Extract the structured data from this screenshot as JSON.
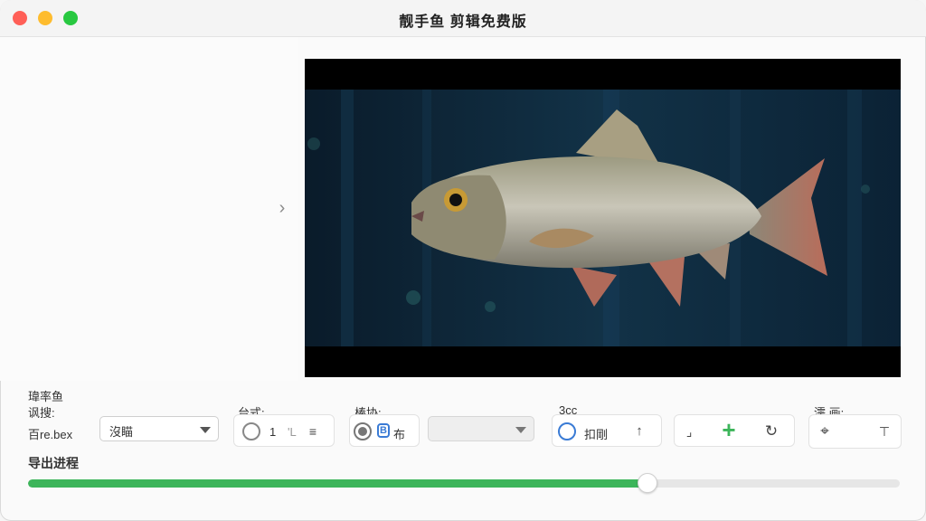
{
  "window": {
    "title": "靓手鱼 剪辑免费版"
  },
  "icons": {
    "chevron": "chevron-right-icon",
    "filter": "filter-lines-icon",
    "arrow_up": "arrow-up-icon",
    "crop": "crop-icon",
    "add": "plus-icon",
    "rotate": "rotate-icon",
    "target": "target-icon",
    "text": "text-icon"
  },
  "colors": {
    "accent_green": "#3cb55a",
    "accent_blue": "#3a7bd5"
  },
  "settings": {
    "section_title": "瑋率鱼",
    "group1": {
      "label": "讽搜:",
      "value_text": "百re.bex",
      "select_value": "沒瞄"
    },
    "group2": {
      "label": "台式:",
      "option_number": "1",
      "option_extra": "'L"
    },
    "group3": {
      "label": "棒协:",
      "badge": "B",
      "badge_text": "布",
      "select_value": ""
    },
    "group4": {
      "label": "3cc",
      "option_text": "扣剛"
    },
    "group5": {
      "label": "濡 画:"
    }
  },
  "export": {
    "label": "导出进程",
    "progress": 0.71
  }
}
